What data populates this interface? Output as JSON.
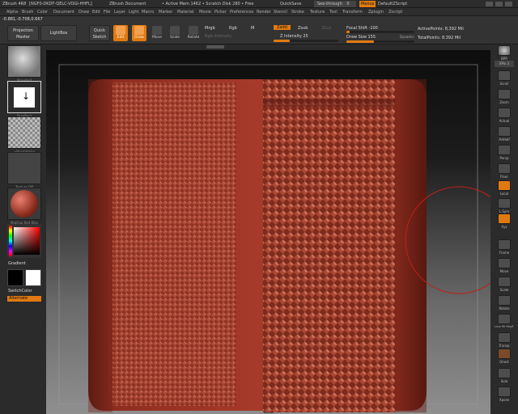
{
  "titlebar": {
    "app": "ZBrush 4R8",
    "build": "[NGF0-DKDF-QELC-VOGI-HHFL]",
    "doc": "ZBrush Document",
    "info": "• Active Mem 1462 • Scratch Disk 280 • Free",
    "quicksave": "QuickSave",
    "seethrough": "See-through",
    "seethrough_value": "0",
    "menus": "Menus",
    "script": "DefaultZScript"
  },
  "menu": [
    "Alpha",
    "Brush",
    "Color",
    "Document",
    "Draw",
    "Edit",
    "File",
    "Layer",
    "Light",
    "Macro",
    "Marker",
    "Material",
    "Movie",
    "Picker",
    "Preferences",
    "Render",
    "Stencil",
    "Stroke",
    "Texture",
    "Tool",
    "Transform",
    "Zplugin",
    "Zscript"
  ],
  "toolbar": {
    "coords": "-0.881,-0.708,0.667",
    "projection_master": "Projection Master",
    "lightbox": "LightBox",
    "quick_sketch": "Quick Sketch",
    "tools": [
      "Edit",
      "Draw",
      "Move",
      "Scale",
      "Rotate"
    ],
    "mrgb": "Mrgb",
    "rgb": "Rgb",
    "m": "M",
    "rgb_intensity": "Rgb Intensity",
    "zadd": "Zadd",
    "zsub": "Zsub",
    "zcut": "Zcut",
    "z_intensity_label": "Z Intensity",
    "z_intensity_value": "25",
    "focal_shift_label": "Focal Shift",
    "focal_shift_value": "-100",
    "draw_size_label": "Draw Size",
    "draw_size_value": "155",
    "dynamic": "Dynamic",
    "active_points": "ActivePoints: 8,392 Mil",
    "total_points": "TotalPoints: 8.392 Mil"
  },
  "leftshelf": {
    "thumbs": [
      "Standard",
      "DragRect",
      "~BrushAlpha",
      "Texture Off",
      "MatCap Red Wax"
    ],
    "gradient": "Gradient",
    "switchcolor": "SwitchColor",
    "alternate": "Alternate"
  },
  "rightshelf": [
    "BPR",
    "SPix 3",
    "Scroll",
    "Zoom",
    "Actual",
    "AAHalf",
    "Persp",
    "Floor",
    "Local",
    "L.Sym",
    "Xyz",
    "Frame",
    "Move",
    "Scale",
    "Rotate",
    "Line Fill PolyF",
    "Transp",
    "Ghost",
    "Solo",
    "Xpose"
  ],
  "colors": {
    "accent": "#e07a10",
    "model": "#8e2e20"
  }
}
